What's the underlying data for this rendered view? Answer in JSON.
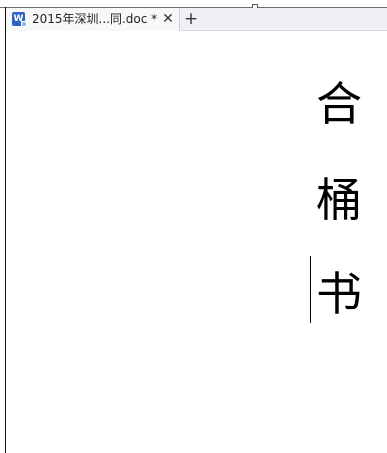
{
  "tab": {
    "icon": "word-doc-icon",
    "icon_letter": "W",
    "title": "2015年深圳...同.doc *",
    "close_glyph": "✕"
  },
  "new_tab_glyph": "+",
  "document": {
    "characters": [
      "合",
      "桶",
      "书"
    ]
  }
}
